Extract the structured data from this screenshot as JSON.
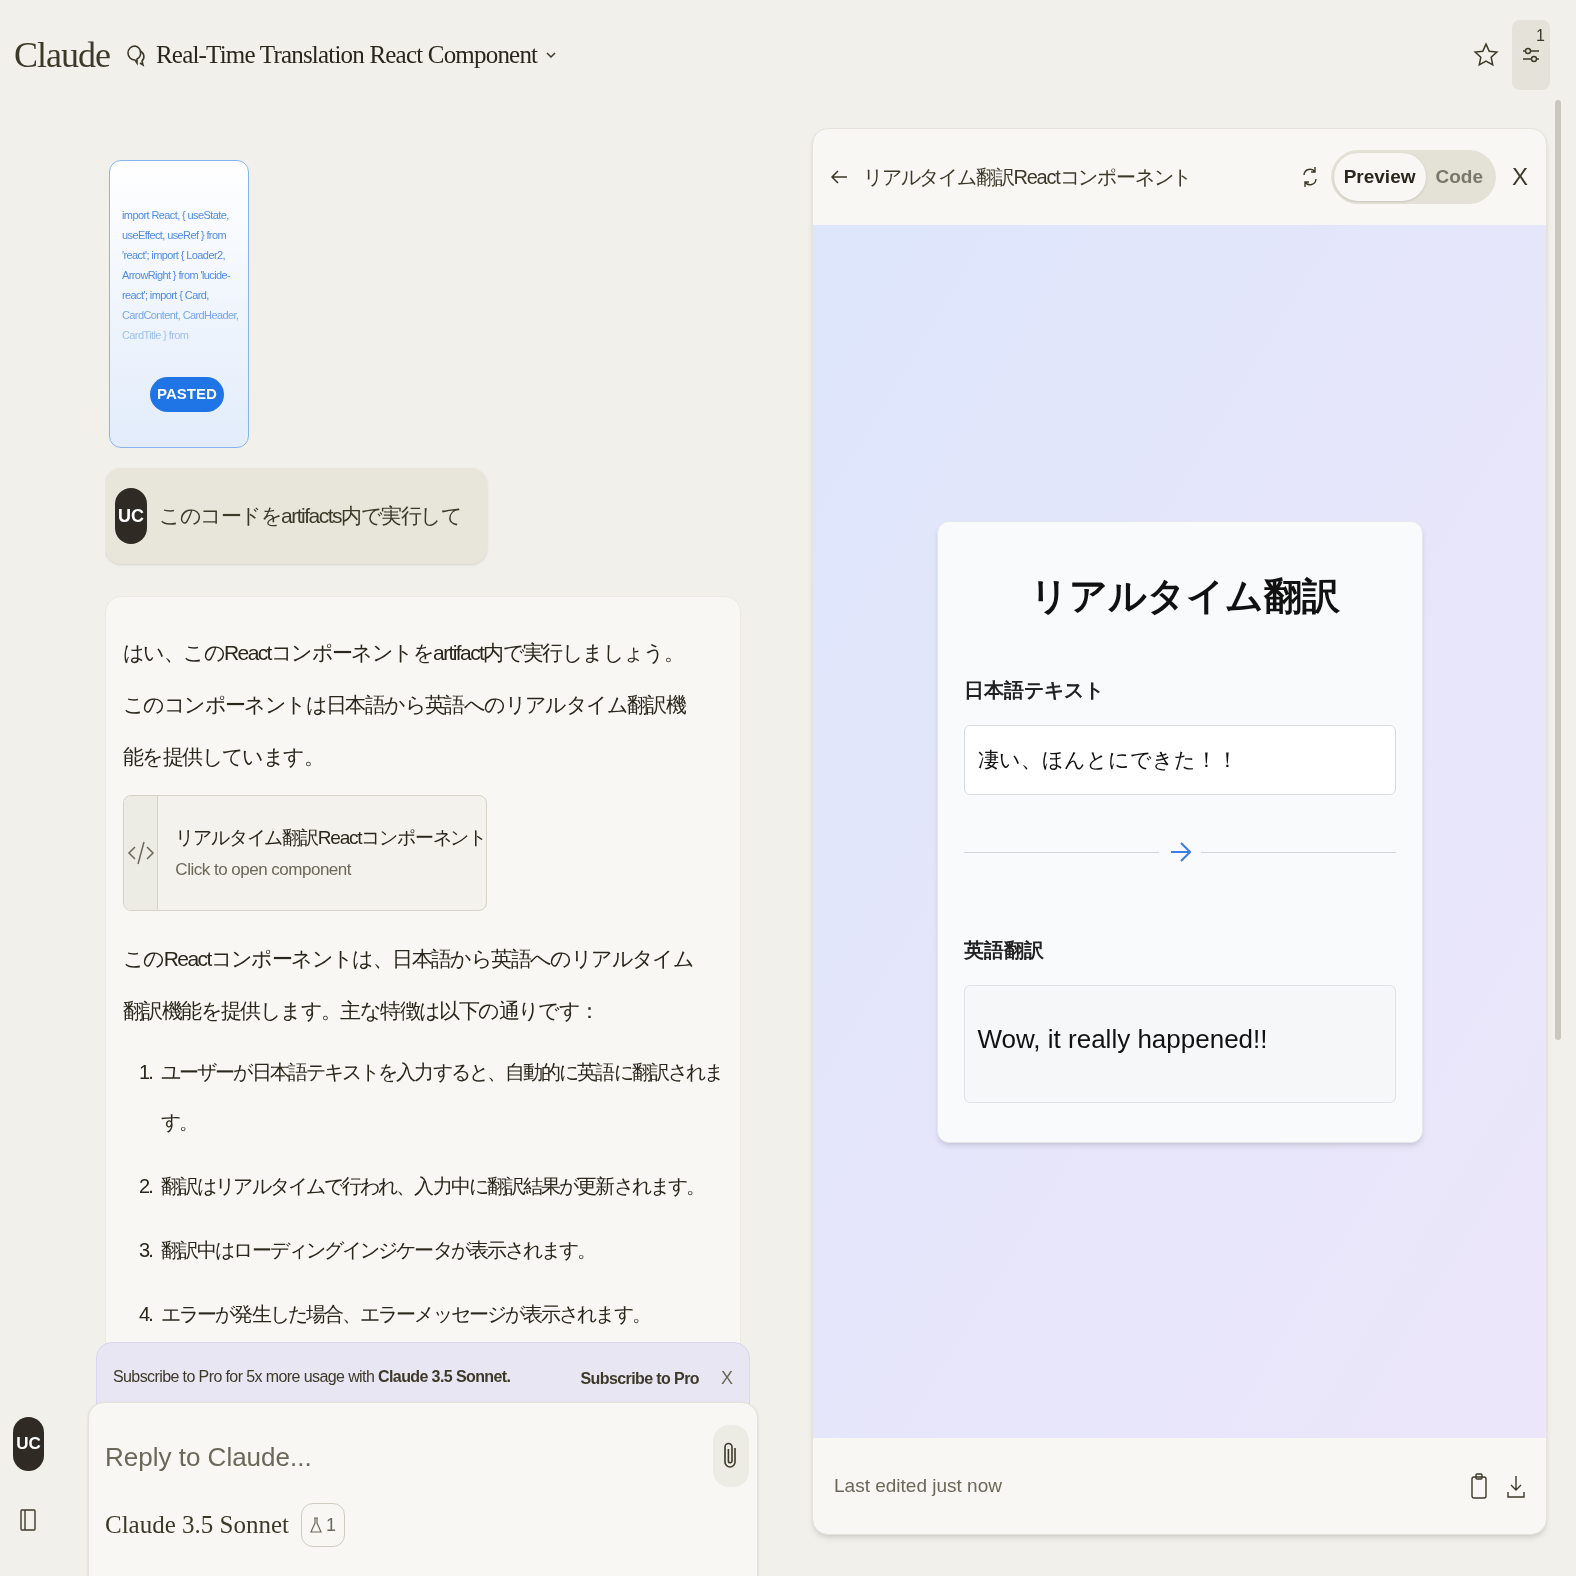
{
  "header": {
    "app_name": "Claude",
    "conversation_title": "Real-Time Translation React Component",
    "settings_badge": "1"
  },
  "user_message": {
    "attachment": {
      "code_lines": [
        "import React, { useState,",
        "useEffect, useRef } from",
        "'react'; import { Loader2,",
        "ArrowRight } from 'lucide-",
        "react'; import { Card,",
        "CardContent, CardHeader,",
        "CardTitle } from"
      ],
      "badge": "PASTED"
    },
    "avatar": "UC",
    "text": "このコードをartifacts内で実行して"
  },
  "assistant_message": {
    "intro": "はい、このReactコンポーネントをartifact内で実行しましょう。このコンポーネントは日本語から英語へのリアルタイム翻訳機能を提供しています。",
    "artifact": {
      "title": "リアルタイム翻訳Reactコンポーネント",
      "subtitle": "Click to open component"
    },
    "body": "このReactコンポーネントは、日本語から英語へのリアルタイム翻訳機能を提供します。主な特徴は以下の通りです：",
    "list": [
      {
        "number": "1.",
        "text": "ユーザーが日本語テキストを入力すると、自動的に英語に翻訳されます。"
      },
      {
        "number": "2.",
        "text": "翻訳はリアルタイムで行われ、入力中に翻訳結果が更新されます。"
      },
      {
        "number": "3.",
        "text": "翻訳中はローディングインジケータが表示されます。"
      },
      {
        "number": "4.",
        "text": "エラーが発生した場合、エラーメッセージが表示されます。"
      }
    ]
  },
  "banner": {
    "text": "Subscribe to Pro for 5x more usage with **Claude 3.5 Sonnet.**",
    "link": "Subscribe to Pro",
    "close": "X"
  },
  "composer": {
    "placeholder": "Reply to Claude...",
    "model": "Claude 3.5 Sonnet",
    "badge_count": "1"
  },
  "sidebar": {
    "avatar": "UC"
  },
  "artifact_panel": {
    "title": "リアルタイム翻訳Reactコンポーネント",
    "tabs": [
      {
        "label": "Preview",
        "selected": true
      },
      {
        "label": "Code",
        "selected": false
      }
    ],
    "close": "X",
    "preview": {
      "heading": "リアルタイム翻訳",
      "input_label": "日本語テキスト",
      "input_value": "凄い、ほんとにできた！！",
      "output_label": "英語翻訳",
      "output_text": "Wow, it really happened!!"
    },
    "footer": "Last edited just now"
  }
}
